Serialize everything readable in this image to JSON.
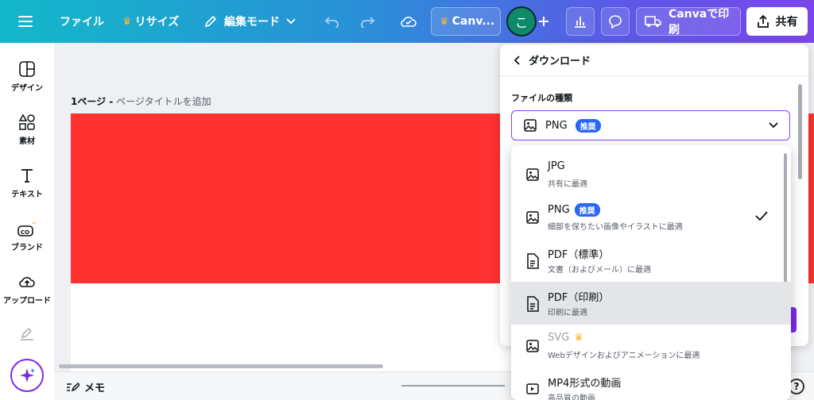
{
  "topbar": {
    "file": "ファイル",
    "resize": "リサイズ",
    "edit_mode": "編集モード",
    "canva_pro": "Canv...",
    "avatar_initial": "こ",
    "print": "Canvaで印刷",
    "share": "共有"
  },
  "sidebar": {
    "items": [
      "デザイン",
      "素材",
      "テキスト",
      "ブランド",
      "アップロード"
    ]
  },
  "canvas": {
    "page_number": "1ページ -",
    "page_title_placeholder": "ページタイトルを追加"
  },
  "bottombar": {
    "memo": "メモ",
    "help": "?"
  },
  "download_panel": {
    "title": "ダウンロード",
    "file_type_label": "ファイルの種類",
    "selected": "PNG",
    "recommended_badge": "推奨"
  },
  "file_options": [
    {
      "title": "JPG",
      "desc": "共有に最適"
    },
    {
      "title": "PNG",
      "desc": "細部を保ちたい画像やイラストに最適",
      "badge": "推奨"
    },
    {
      "title": "PDF（標準）",
      "desc": "文書（およびメール）に最適"
    },
    {
      "title": "PDF（印刷）",
      "desc": "印刷に最適"
    },
    {
      "title": "SVG",
      "desc": "Webデザインおよびアニメーションに最適"
    },
    {
      "title": "MP4形式の動画",
      "desc": "高品質の動画"
    }
  ],
  "colors": {
    "accent": "#8b3dff",
    "badge": "#2a66f5",
    "red": "#ff3131"
  }
}
